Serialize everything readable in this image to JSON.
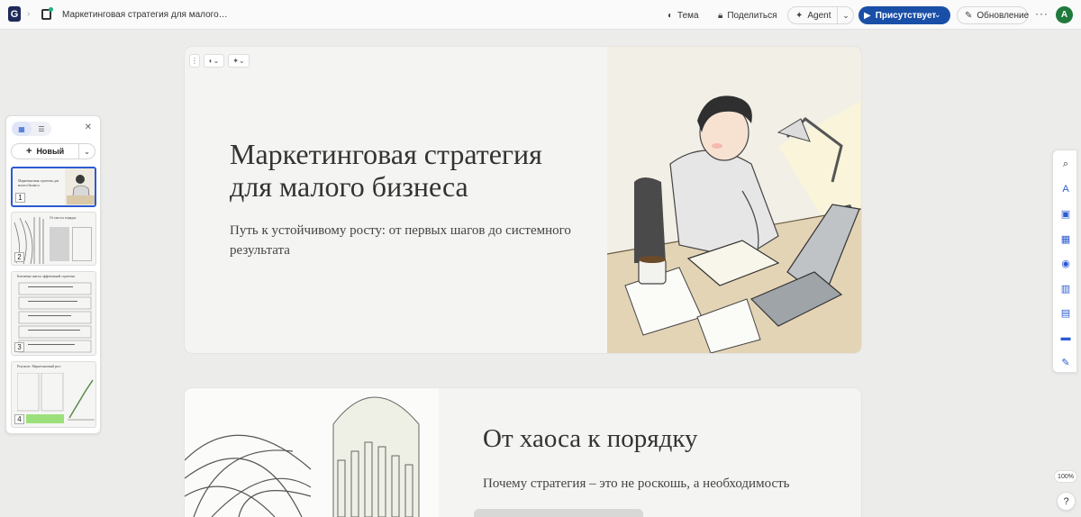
{
  "topbar": {
    "logo": "G",
    "doc_title": "Маркетинговая стратегия для малого…",
    "theme_label": "Тема",
    "share_label": "Поделиться",
    "agent_label": "Agent",
    "present_label": "Присутствует",
    "update_label": "Обновление",
    "more_label": "···",
    "avatar_letter": "A"
  },
  "panel": {
    "new_label": "Новый",
    "thumbs": [
      {
        "number": "1",
        "title": "Маркетинговая стратегия для малого бизнеса"
      },
      {
        "number": "2",
        "title": "От хаоса к порядку"
      },
      {
        "number": "3",
        "title": "Ключевые шаги к эффективной стратегии"
      },
      {
        "number": "4",
        "title": "Результат: Маркетинговый рост"
      }
    ]
  },
  "slides": [
    {
      "title": "Маркетинговая стратегия для малого бизнеса",
      "subtitle": "Путь к устойчивому росту: от первых шагов до системного результата"
    },
    {
      "title": "От хаоса к порядку",
      "subtitle": "Почему стратегия – это не роскошь, а необходимость"
    }
  ],
  "zoom": "100%",
  "help": "?",
  "colors": {
    "accent": "#2b5bd0",
    "present_bg": "#1a4fa8",
    "avatar_bg": "#1f7a3c"
  }
}
